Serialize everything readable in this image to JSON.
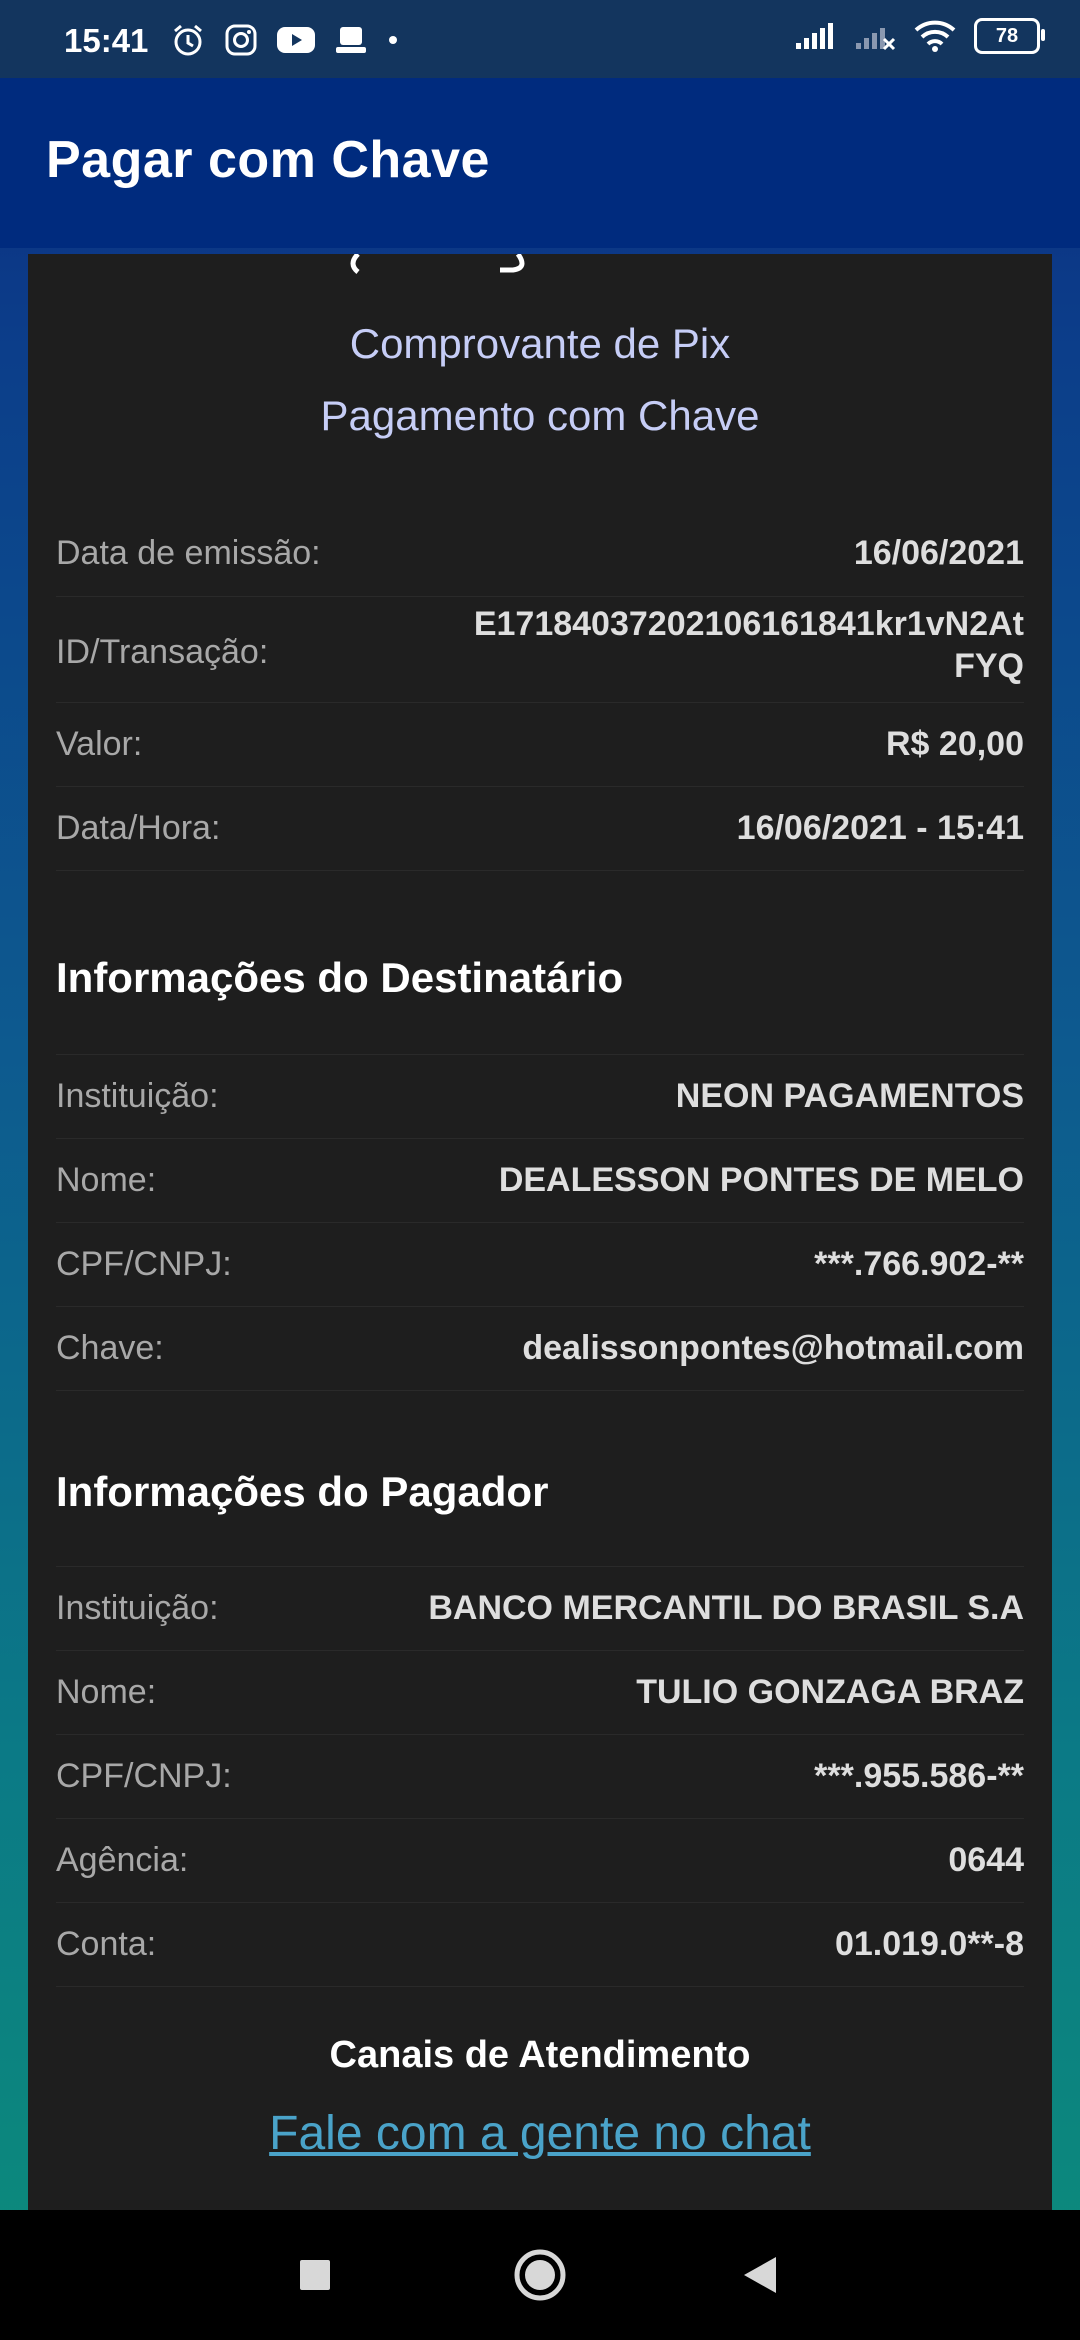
{
  "status_bar": {
    "time": "15:41",
    "battery": "78"
  },
  "app_bar": {
    "title": "Pagar com Chave"
  },
  "receipt": {
    "title": "Comprovante de Pix",
    "subtitle": "Pagamento com Chave",
    "transaction": [
      {
        "label": "Data de emissão:",
        "value": "16/06/2021"
      },
      {
        "label": "ID/Transação:",
        "value_line1": "E17184037202106161841kr1vN2At",
        "value_line2": "FYQ"
      },
      {
        "label": "Valor:",
        "value": "R$ 20,00"
      },
      {
        "label": "Data/Hora:",
        "value": "16/06/2021 - 15:41"
      }
    ],
    "recipient_heading": "Informações do Destinatário",
    "recipient": [
      {
        "label": "Instituição:",
        "value": "NEON PAGAMENTOS"
      },
      {
        "label": "Nome:",
        "value": "DEALESSON PONTES DE MELO"
      },
      {
        "label": "CPF/CNPJ:",
        "value": "***.766.902-**"
      },
      {
        "label": "Chave:",
        "value": "dealissonpontes@hotmail.com"
      }
    ],
    "payer_heading": "Informações do Pagador",
    "payer": [
      {
        "label": "Instituição:",
        "value": "BANCO MERCANTIL DO BRASIL S.A"
      },
      {
        "label": "Nome:",
        "value": "TULIO GONZAGA BRAZ"
      },
      {
        "label": "CPF/CNPJ:",
        "value": "***.955.586-**"
      },
      {
        "label": "Agência:",
        "value": "0644"
      },
      {
        "label": "Conta:",
        "value": "01.019.0**-8"
      }
    ],
    "support_heading": "Canais de Atendimento",
    "chat_link": "Fale com a gente no chat"
  },
  "nav_bar": {
    "icons": [
      "recents-icon",
      "home-icon",
      "back-icon"
    ]
  }
}
